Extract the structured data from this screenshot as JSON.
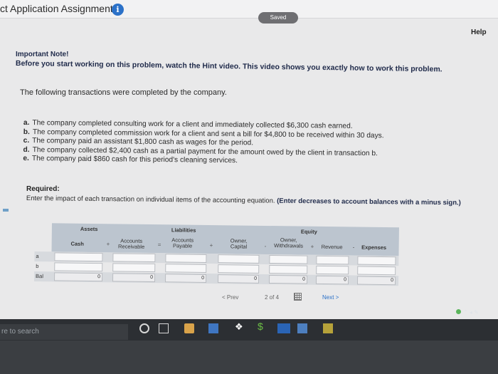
{
  "header": {
    "app_title": "ct Application Assignment",
    "info_glyph": "i",
    "saved": "Saved",
    "help": "Help"
  },
  "note": {
    "heading": "Important Note!",
    "body": "Before you start working on this problem, watch the Hint video. This video shows you exactly how to work this problem."
  },
  "problem": {
    "lead": "The following transactions were completed by the company.",
    "transactions": [
      {
        "letter": "a.",
        "text": "The company completed consulting work for a client and immediately collected $6,300 cash earned."
      },
      {
        "letter": "b.",
        "text": "The company completed commission work for a client and sent a bill for $4,800 to be received within 30 days."
      },
      {
        "letter": "c.",
        "text": "The company paid an assistant $1,800 cash as wages for the period."
      },
      {
        "letter": "d.",
        "text": "The company collected $2,400 cash as a partial payment for the amount owed by the client in transaction b."
      },
      {
        "letter": "e.",
        "text": "The company paid $860 cash for this period's cleaning services."
      }
    ],
    "required_heading": "Required:",
    "required_text": "Enter the impact of each transaction on individual items of the accounting equation.",
    "required_emphasis": "(Enter decreases to account balances with a minus sign.)"
  },
  "equation": {
    "groups": {
      "assets": "Assets",
      "liabilities": "Liabilities",
      "equity": "Equity"
    },
    "columns": {
      "cash": "Cash",
      "accounts_receivable": "Accounts Receivable",
      "accounts_payable": "Accounts Payable",
      "owner_capital": "Owner, Capital",
      "owner_withdrawals": "Owner, Withdrawals",
      "revenue": "Revenue",
      "expenses": "Expenses"
    },
    "operators": {
      "plus": "+",
      "equals": "=",
      "minus": "-"
    },
    "rows": [
      {
        "label": "a",
        "values": [
          "",
          "",
          "",
          "",
          "",
          "",
          ""
        ]
      },
      {
        "label": "b",
        "values": [
          "",
          "",
          "",
          "",
          "",
          "",
          ""
        ]
      },
      {
        "label": "Bal",
        "values": [
          "0",
          "0",
          "0",
          "0",
          "0",
          "0",
          "0"
        ]
      }
    ]
  },
  "pager": {
    "prev": "< Prev",
    "position": "2 of 4",
    "next": "Next >"
  },
  "taskbar": {
    "search_placeholder": "re to search"
  }
}
